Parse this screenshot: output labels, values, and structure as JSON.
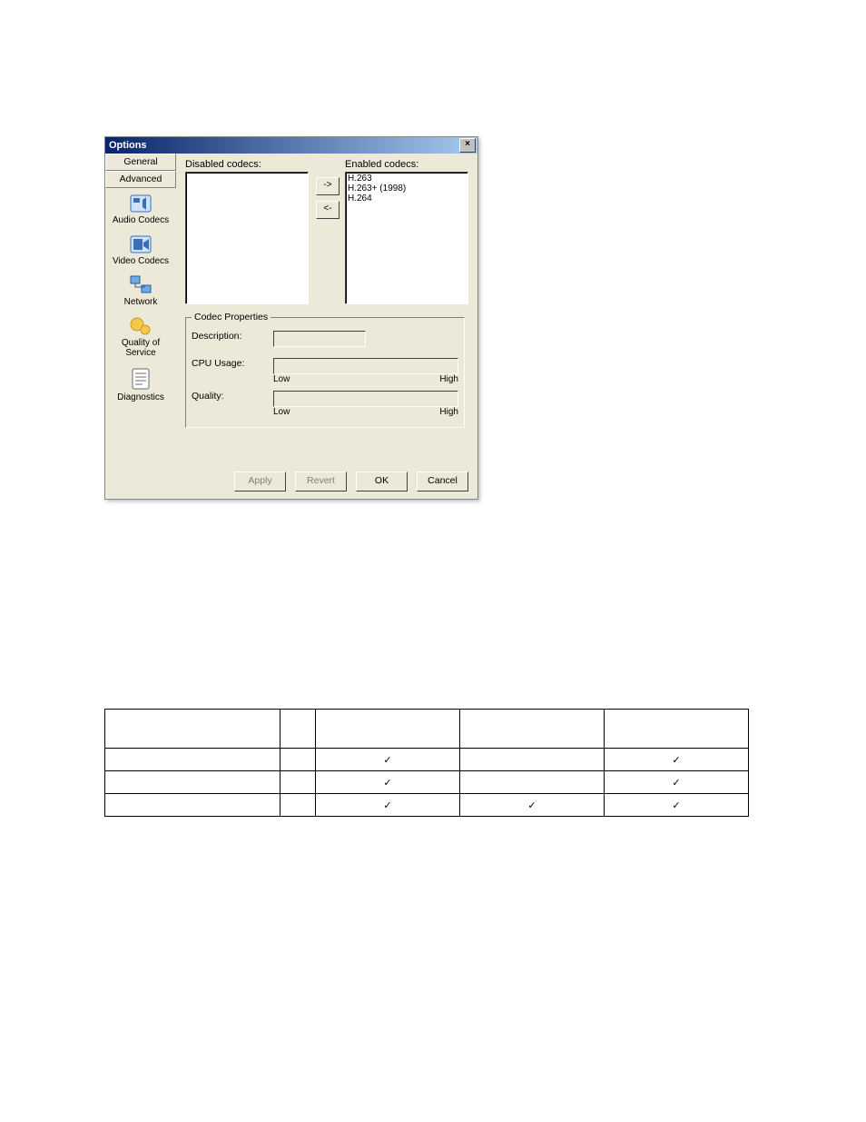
{
  "dialog": {
    "title": "Options",
    "tabs": {
      "general": "General",
      "advanced": "Advanced"
    },
    "sidebar": {
      "items": [
        {
          "label": "Audio Codecs"
        },
        {
          "label": "Video Codecs"
        },
        {
          "label": "Network"
        },
        {
          "label": "Quality of Service"
        },
        {
          "label": "Diagnostics"
        }
      ]
    },
    "panel": {
      "disabled_label": "Disabled codecs:",
      "enabled_label": "Enabled codecs:",
      "move_right": "->",
      "move_left": "<-",
      "enabled_codecs": [
        "H.263",
        "H.263+ (1998)",
        "H.264"
      ],
      "disabled_codecs": []
    },
    "group": {
      "title": "Codec Properties",
      "description_label": "Description:",
      "cpu_label": "CPU Usage:",
      "quality_label": "Quality:",
      "low": "Low",
      "high": "High",
      "description_value": ""
    },
    "buttons": {
      "apply": "Apply",
      "revert": "Revert",
      "ok": "OK",
      "cancel": "Cancel"
    }
  },
  "table": {
    "headers": [
      "",
      "",
      "",
      "",
      ""
    ],
    "rows": [
      {
        "c": [
          "",
          "",
          "✓",
          "",
          "✓"
        ]
      },
      {
        "c": [
          "",
          "",
          "✓",
          "",
          "✓"
        ]
      },
      {
        "c": [
          "",
          "",
          "✓",
          "✓",
          "✓"
        ]
      }
    ]
  }
}
